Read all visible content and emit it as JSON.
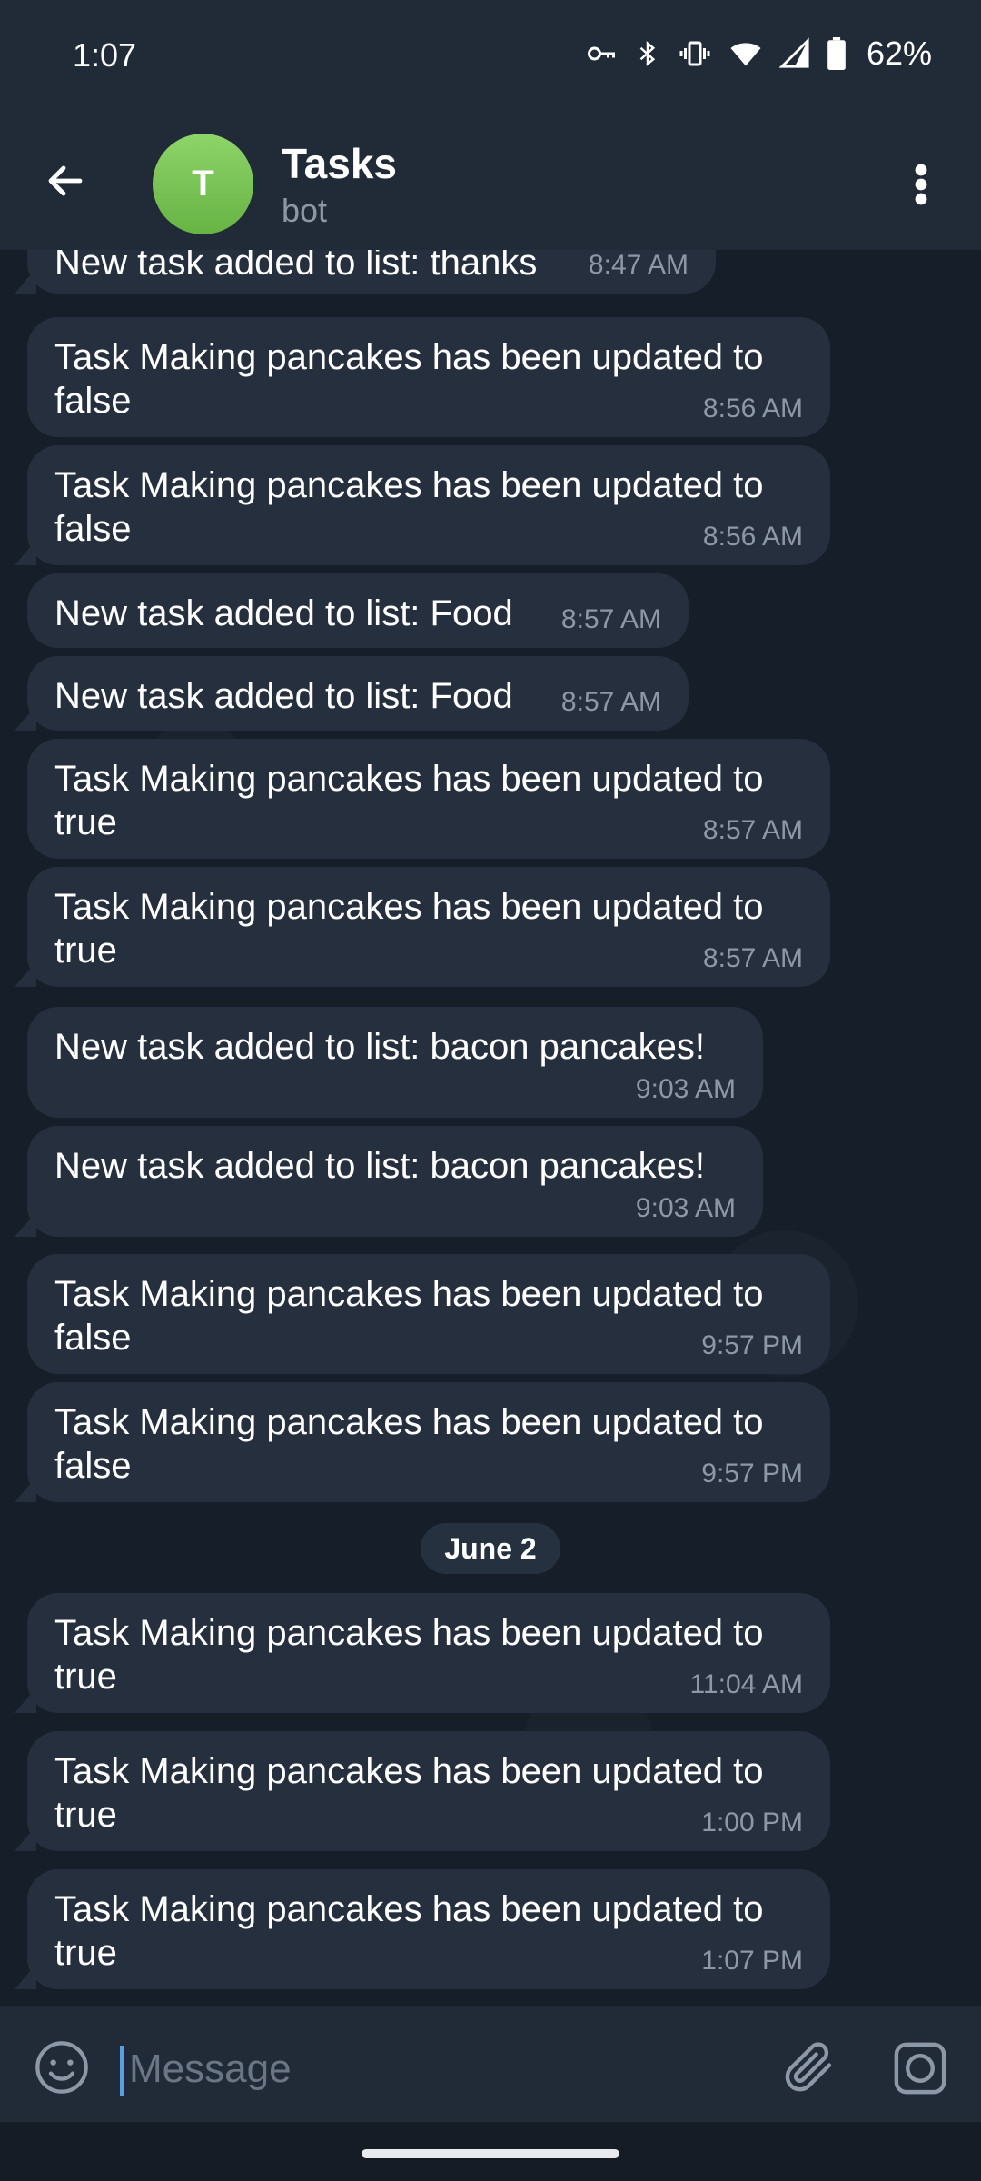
{
  "status_bar": {
    "time": "1:07",
    "battery": "62%"
  },
  "header": {
    "avatar_letter": "T",
    "title": "Tasks",
    "subtitle": "bot"
  },
  "messages": [
    {
      "text": "New task added to list: thanks",
      "time": "8:47 AM"
    },
    {
      "text": "Task Making pancakes has been updated to false",
      "time": "8:56 AM"
    },
    {
      "text": "Task Making pancakes has been updated to false",
      "time": "8:56 AM"
    },
    {
      "text": "New task added to list: Food",
      "time": "8:57 AM"
    },
    {
      "text": "New task added to list: Food",
      "time": "8:57 AM"
    },
    {
      "text": "Task Making pancakes has been updated to true",
      "time": "8:57 AM"
    },
    {
      "text": "Task Making pancakes has been updated to true",
      "time": "8:57 AM"
    },
    {
      "text": "New task added to list: bacon pancakes!",
      "time": "9:03 AM"
    },
    {
      "text": "New task added to list: bacon pancakes!",
      "time": "9:03 AM"
    },
    {
      "text": "Task Making pancakes has been updated to false",
      "time": "9:57 PM"
    },
    {
      "text": "Task Making pancakes has been updated to false",
      "time": "9:57 PM"
    },
    {
      "text": "Task Making pancakes has been updated to true",
      "time": "11:04 AM"
    },
    {
      "text": "Task Making pancakes has been updated to true",
      "time": "1:00 PM"
    },
    {
      "text": "Task Making pancakes has been updated to true",
      "time": "1:07 PM"
    }
  ],
  "date_separator": "June 2",
  "composer": {
    "placeholder": "Message"
  },
  "icons": {
    "back": "arrow-left-icon",
    "menu": "more-vertical-icon",
    "emoji": "smile-icon",
    "attach": "paperclip-icon",
    "camera": "camera-icon"
  },
  "colors": {
    "bubble": "#262f3d",
    "header": "#212b38",
    "avatar": "#7cc456",
    "cursor": "#5a9fe0"
  }
}
